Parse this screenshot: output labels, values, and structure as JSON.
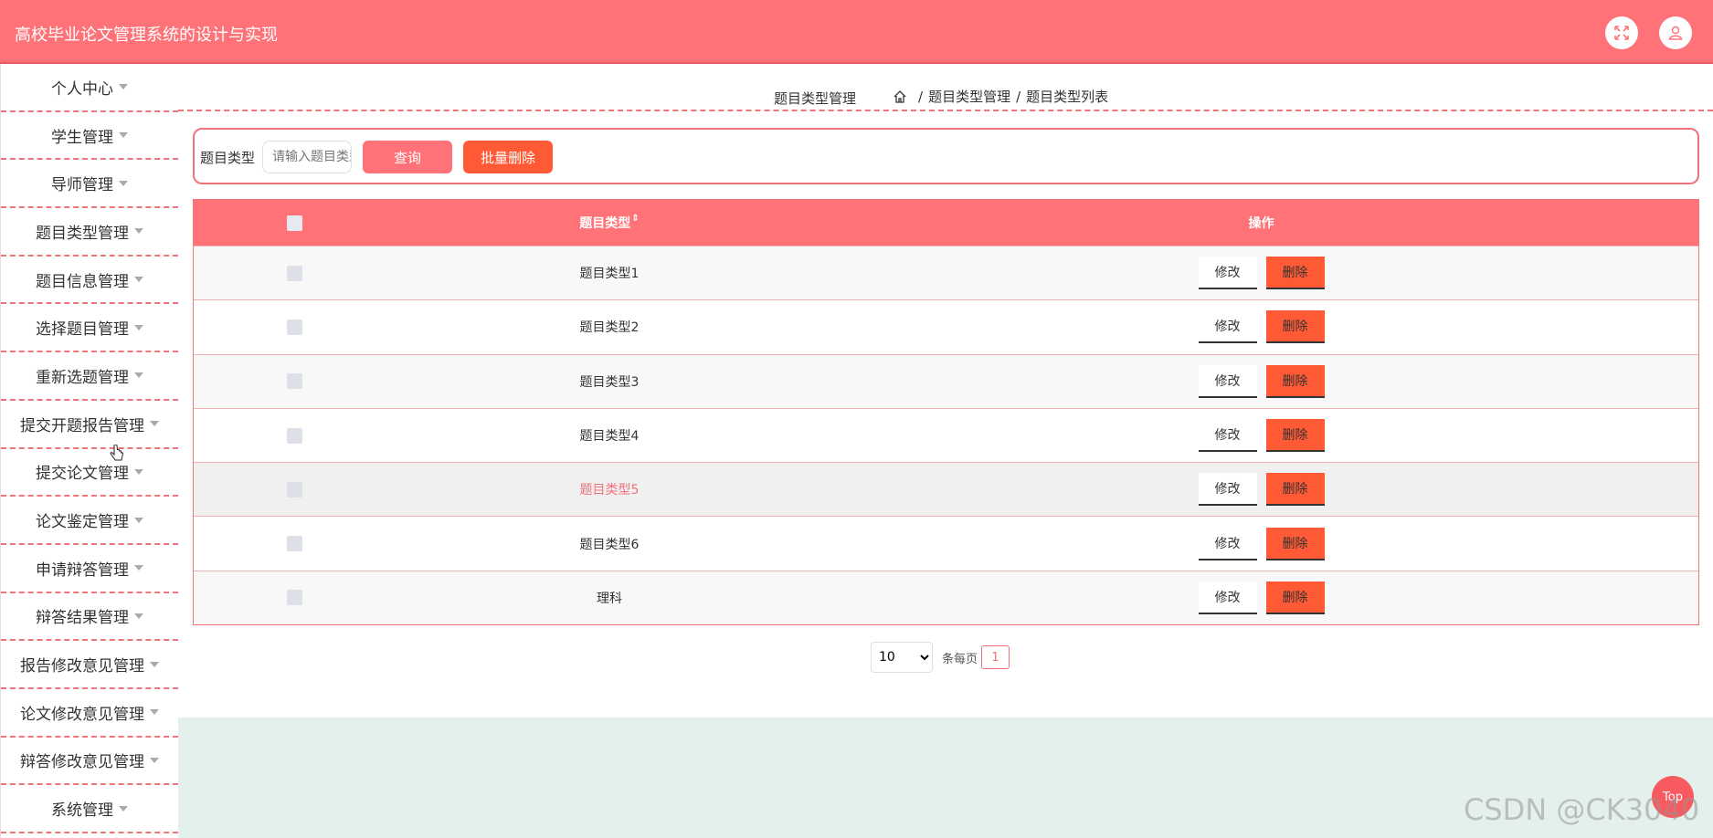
{
  "header": {
    "title": "高校毕业论文管理系统的设计与实现"
  },
  "sidebar": {
    "items": [
      {
        "label": "个人中心"
      },
      {
        "label": "学生管理"
      },
      {
        "label": "导师管理"
      },
      {
        "label": "题目类型管理"
      },
      {
        "label": "题目信息管理"
      },
      {
        "label": "选择题目管理"
      },
      {
        "label": "重新选题管理"
      },
      {
        "label": "提交开题报告管理"
      },
      {
        "label": "提交论文管理"
      },
      {
        "label": "论文鉴定管理"
      },
      {
        "label": "申请辩答管理"
      },
      {
        "label": "辩答结果管理"
      },
      {
        "label": "报告修改意见管理"
      },
      {
        "label": "论文修改意见管理"
      },
      {
        "label": "辩答修改意见管理"
      },
      {
        "label": "系统管理"
      }
    ]
  },
  "breadcrumb": {
    "title": "题目类型管理",
    "path": [
      "题目类型管理",
      "题目类型列表"
    ],
    "sep": "/"
  },
  "search": {
    "label": "题目类型",
    "placeholder": "请输入题目类型",
    "query_label": "查询",
    "batch_delete_label": "批量删除"
  },
  "table": {
    "col_type": "题目类型",
    "sort_glyph": "⇕",
    "col_ops": "操作",
    "edit_label": "修改",
    "delete_label": "删除",
    "rows": [
      "题目类型1",
      "题目类型2",
      "题目类型3",
      "题目类型4",
      "题目类型5",
      "题目类型6",
      "理科"
    ]
  },
  "pager": {
    "page_size": "10",
    "per_page_label": "条每页",
    "current_page": "1"
  },
  "top_label": "Top",
  "watermark": "CSDN @CK3040",
  "colors": {
    "primary": "#ff7378",
    "danger": "#ff5a35",
    "lower_bg": "#e4f0ec"
  }
}
